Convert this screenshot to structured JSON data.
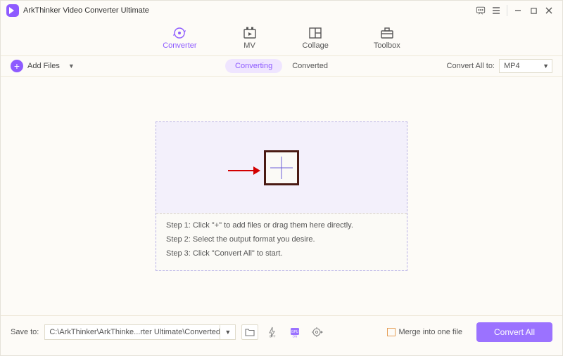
{
  "app": {
    "title": "ArkThinker Video Converter Ultimate"
  },
  "tabs": {
    "converter": "Converter",
    "mv": "MV",
    "collage": "Collage",
    "toolbox": "Toolbox"
  },
  "toolbar": {
    "add_files": "Add Files",
    "converting": "Converting",
    "converted": "Converted",
    "convert_all_to": "Convert All to:",
    "format_selected": "MP4"
  },
  "drop": {
    "step1": "Step 1: Click \"+\" to add files or drag them here directly.",
    "step2": "Step 2: Select the output format you desire.",
    "step3": "Step 3: Click \"Convert All\" to start."
  },
  "footer": {
    "save_to": "Save to:",
    "path": "C:\\ArkThinker\\ArkThinke...rter Ultimate\\Converted",
    "merge": "Merge into one file",
    "convert_all": "Convert All"
  }
}
